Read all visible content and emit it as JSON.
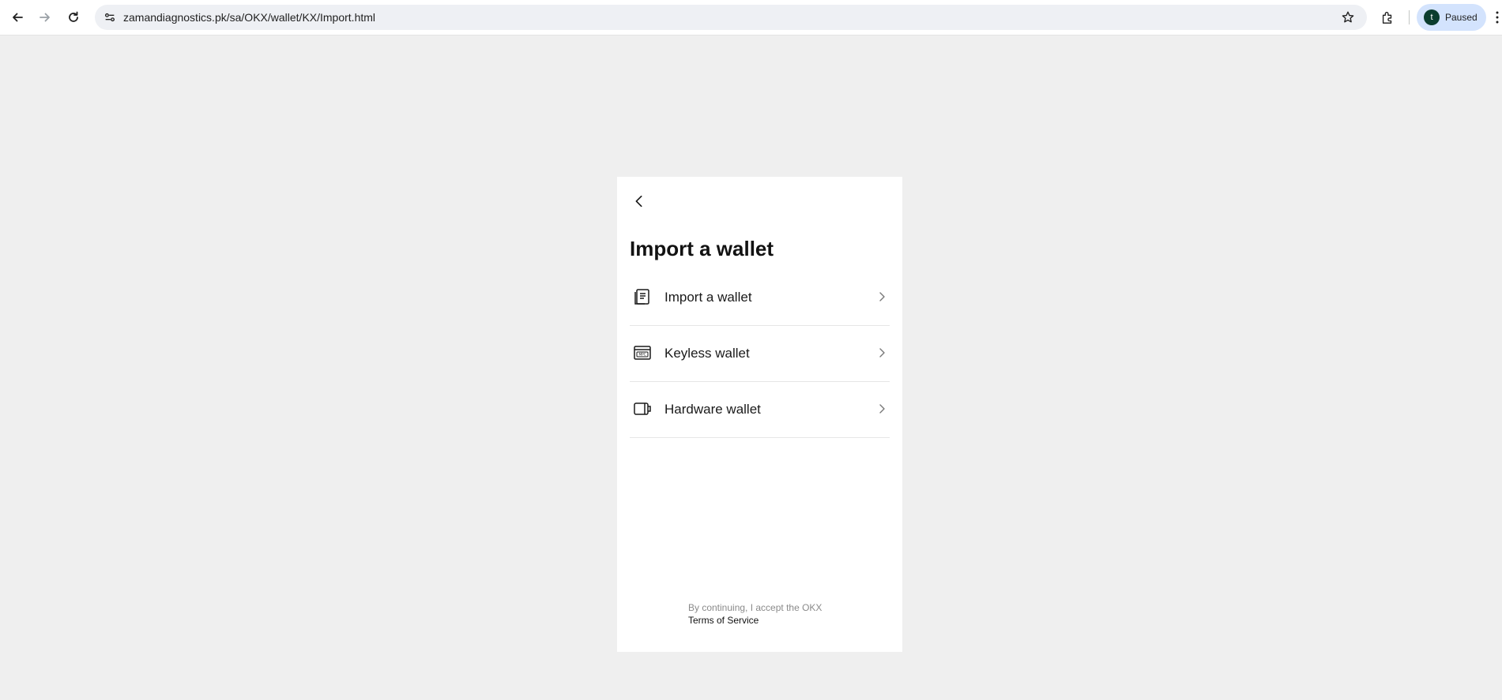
{
  "browser": {
    "url": "zamandiagnostics.pk/sa/OKX/wallet/KX/Import.html",
    "profile_initial": "t",
    "profile_status": "Paused",
    "icons": [
      "back-arrow-icon",
      "forward-arrow-icon",
      "reload-icon",
      "site-info-icon",
      "star-icon",
      "extensions-icon",
      "more-menu-icon"
    ]
  },
  "page": {
    "title": "Import a wallet",
    "options": [
      {
        "label": "Import a wallet",
        "icon": "import-wallet-icon"
      },
      {
        "label": "Keyless wallet",
        "icon": "mpc-keyless-icon",
        "icon_text": "MPC"
      },
      {
        "label": "Hardware wallet",
        "icon": "hardware-wallet-icon"
      }
    ],
    "footer": {
      "text": "By continuing, I accept the OKX",
      "link": "Terms of Service"
    }
  },
  "colors": {
    "page_background": "#efefef",
    "card_background": "#ffffff",
    "title_text": "#121212",
    "muted_text": "#8a8a8a",
    "profile_chip": "#d3e3fd",
    "avatar": "#0b3d2e"
  }
}
